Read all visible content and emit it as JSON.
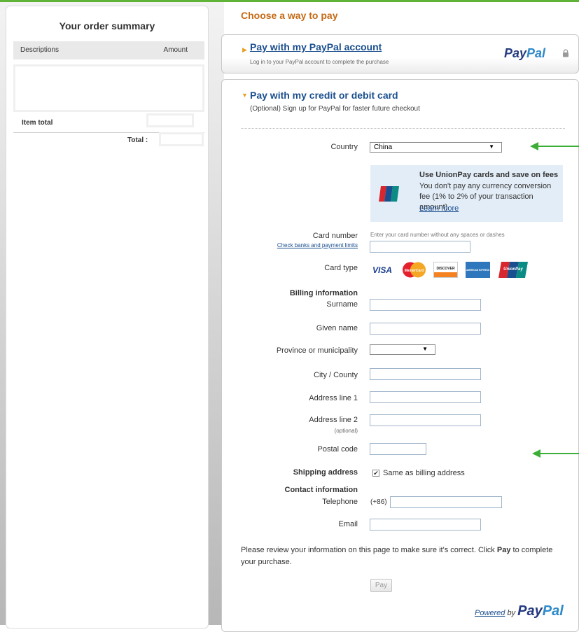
{
  "colors": {
    "accent_green": "#5fb336",
    "orange_heading": "#c56a15",
    "link_blue": "#1a4e8e",
    "paypal_dark": "#263b80",
    "paypal_light": "#2e8ac9"
  },
  "summary": {
    "title": "Your order summary",
    "col_description": "Descriptions",
    "col_amount": "Amount",
    "item_total_label": "Item total",
    "total_label": "Total :"
  },
  "main": {
    "heading": "Choose a way to pay",
    "paypal_option": {
      "title": "Pay with my PayPal account",
      "subtitle": "Log in to your PayPal account to complete the purchase",
      "logo_pay": "Pay",
      "logo_pal": "Pal"
    },
    "card_option": {
      "title": "Pay with my credit or debit card",
      "subtitle": "(Optional) Sign up for PayPal for faster future checkout"
    }
  },
  "form": {
    "country_label": "Country",
    "country_value": "China",
    "unionpay": {
      "title": "Use UnionPay cards and save on fees",
      "body": "You don't pay any currency conversion fee (1% to 2% of your transaction amount)",
      "link": "Learn more",
      "logo_text": "UnionPay"
    },
    "card_number_label": "Card number",
    "card_number_hint": "Enter your card number without any spaces or dashes",
    "check_banks_link": "Check banks and payment limits",
    "card_type_label": "Card type",
    "cards": {
      "visa": "VISA",
      "mastercard": "MasterCard",
      "discover": "DISCOVER",
      "amex": "AMERICAN EXPRESS",
      "unionpay": "UnionPay"
    },
    "billing_heading": "Billing information",
    "surname_label": "Surname",
    "given_name_label": "Given name",
    "province_label": "Province or municipality",
    "province_value": "",
    "city_label": "City / County",
    "address1_label": "Address line 1",
    "address2_label": "Address line 2",
    "optional_label": "(optional)",
    "postal_label": "Postal code",
    "shipping_label": "Shipping address",
    "same_as_billing": "Same as billing address",
    "same_as_billing_checked": true,
    "contact_heading": "Contact information",
    "telephone_label": "Telephone",
    "phone_prefix": "(+86)",
    "email_label": "Email"
  },
  "footer": {
    "review_before": "Please review your information on this page to make sure it's correct. Click ",
    "review_pay_word": "Pay",
    "review_after": " to complete your purchase.",
    "pay_button": "Pay",
    "powered_word": "Powered",
    "by_word": " by ",
    "logo_pay": "Pay",
    "logo_pal": "Pal"
  }
}
